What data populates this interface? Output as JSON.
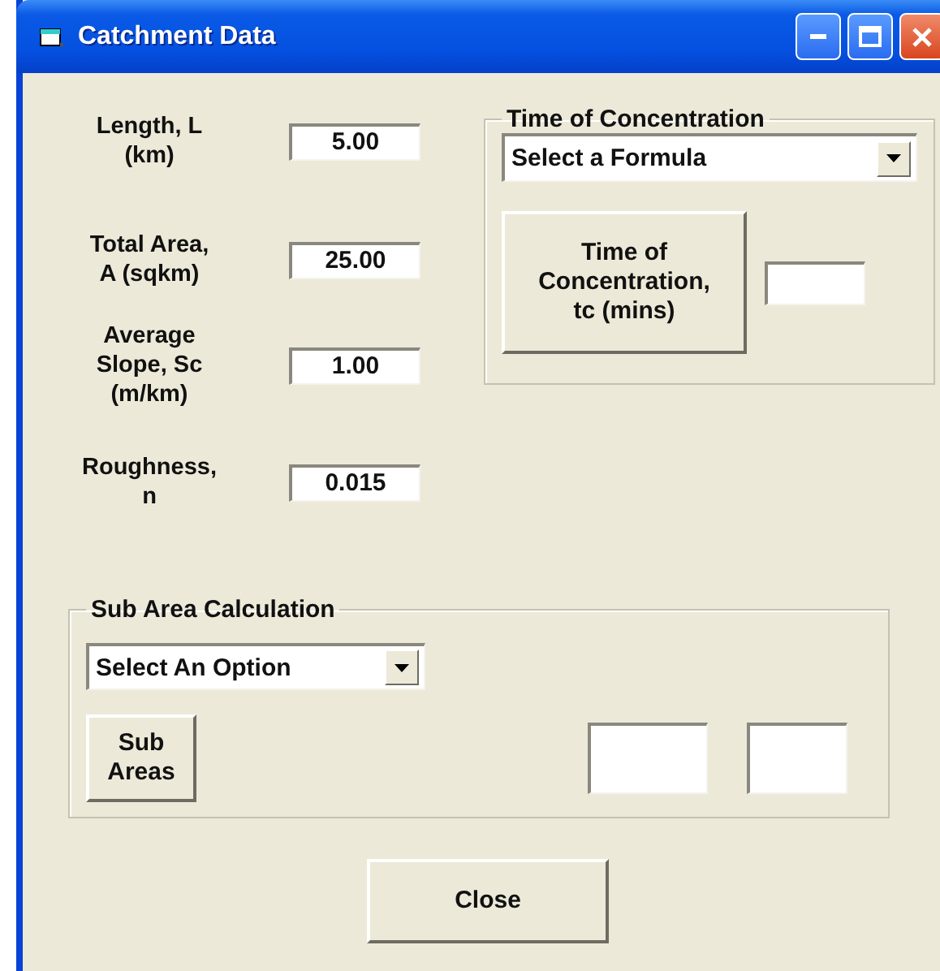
{
  "window": {
    "title": "Catchment Data"
  },
  "inputs": [
    {
      "label": "Length, L\n(km)",
      "value": "5.00"
    },
    {
      "label": "Total Area,\nA (sqkm)",
      "value": "25.00"
    },
    {
      "label": "Average\nSlope, Sc\n(m/km)",
      "value": "1.00"
    },
    {
      "label": "Roughness,\nn",
      "value": "0.015"
    }
  ],
  "time_of_concentration": {
    "title": "Time of Concentration",
    "formula_dropdown": "Select a Formula",
    "button": "Time of\nConcentration,\ntc (mins)"
  },
  "sub_area_calculation": {
    "title": "Sub Area Calculation",
    "option_dropdown": "Select An Option",
    "button": "Sub\nAreas"
  },
  "buttons": [
    "Close"
  ]
}
